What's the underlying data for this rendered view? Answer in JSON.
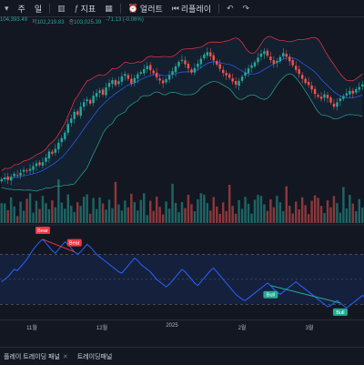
{
  "toolbar": {
    "interval_label": "주",
    "interval_label2": "일",
    "indicators_label": "지표",
    "alert_label": "얼러트",
    "replay_label": "리플레이",
    "undo_icon": "undo-icon",
    "redo_icon": "redo-icon"
  },
  "ohlc": {
    "o": "104,393.49",
    "h_label": "저",
    "h": "102,219.83",
    "c_label": "종",
    "c": "103,025.39",
    "change": "-71.13 (-0.06%)"
  },
  "time_axis": [
    "11월",
    "12월",
    "2025",
    "2월",
    "3월"
  ],
  "tabs": [
    {
      "label": "플레이 트레이딩 패널"
    },
    {
      "label": "트레이딩패널"
    }
  ],
  "colors": {
    "up": "#26a69a",
    "down": "#ef5350",
    "rsi": "#2962ff",
    "bb_upper": "#f23645",
    "bb_lower": "#22ab94",
    "bb_mid": "#2962ff",
    "bear_badge": "#f23645",
    "bull_badge": "#22ab94"
  },
  "chart_data": {
    "type": "candlestick",
    "x_labels": [
      "11월",
      "12월",
      "2025",
      "2월",
      "3월"
    ],
    "close": [
      68.5,
      69.0,
      68.3,
      69.2,
      70.1,
      69.6,
      70.4,
      71.2,
      70.8,
      71.5,
      72.3,
      73.1,
      72.6,
      73.4,
      74.8,
      76.5,
      75.9,
      77.3,
      79.1,
      80.4,
      82.0,
      84.5,
      86.1,
      88.0,
      87.2,
      89.5,
      90.8,
      91.6,
      90.4,
      92.7,
      93.5,
      94.2,
      93.0,
      95.1,
      96.4,
      97.2,
      95.8,
      96.9,
      98.3,
      99.0,
      97.6,
      96.2,
      97.8,
      98.9,
      99.5,
      100.4,
      101.3,
      100.1,
      99.2,
      98.0,
      97.1,
      96.3,
      97.5,
      98.6,
      99.8,
      101.2,
      102.5,
      103.1,
      101.8,
      100.6,
      99.4,
      100.7,
      102.0,
      103.4,
      104.6,
      105.3,
      104.1,
      102.9,
      101.7,
      100.5,
      99.3,
      98.6,
      97.9,
      96.8,
      95.9,
      97.0,
      98.2,
      99.4,
      100.6,
      101.5,
      102.4,
      103.7,
      104.9,
      105.6,
      104.3,
      103.0,
      101.9,
      102.8,
      103.9,
      105.1,
      104.0,
      102.7,
      101.5,
      100.2,
      99.0,
      97.6,
      96.4,
      95.8,
      94.5,
      93.2,
      92.4,
      91.8,
      93.1,
      92.0,
      90.7,
      89.5,
      90.8,
      91.9,
      92.6,
      93.4,
      94.1,
      93.3,
      94.6,
      95.2,
      96.0
    ],
    "rsi": [
      48,
      50,
      52,
      55,
      58,
      57,
      60,
      63,
      66,
      70,
      74,
      77,
      80,
      82,
      79,
      76,
      73,
      71,
      74,
      77,
      80,
      78,
      75,
      72,
      70,
      72,
      75,
      78,
      76,
      73,
      70,
      68,
      66,
      64,
      62,
      60,
      58,
      56,
      55,
      58,
      61,
      64,
      67,
      65,
      62,
      60,
      58,
      56,
      53,
      50,
      48,
      46,
      44,
      46,
      49,
      52,
      55,
      58,
      56,
      53,
      50,
      47,
      45,
      48,
      51,
      54,
      57,
      59,
      56,
      53,
      50,
      47,
      44,
      41,
      38,
      36,
      34,
      33,
      35,
      37,
      39,
      41,
      43,
      45,
      47,
      45,
      42,
      40,
      38,
      40,
      42,
      44,
      46,
      48,
      46,
      44,
      42,
      40,
      38,
      36,
      34,
      32,
      30,
      28,
      29,
      31,
      33,
      31,
      29,
      27,
      29,
      31,
      33,
      35,
      37,
      36,
      38,
      40,
      42
    ],
    "labels": [
      {
        "text": "Bear",
        "i": 13
      },
      {
        "text": "Bear",
        "i": 23
      },
      {
        "text": "Bull",
        "i": 85
      },
      {
        "text": "Bull",
        "i": 107
      }
    ]
  }
}
